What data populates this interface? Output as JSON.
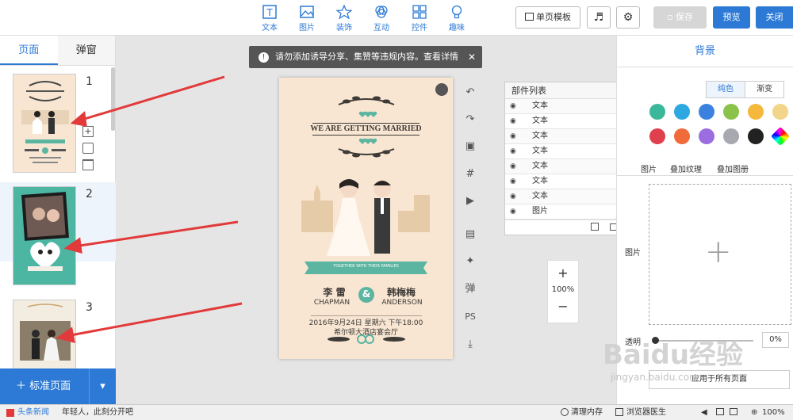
{
  "toolbar": {
    "tools": [
      "文本",
      "图片",
      "装饰",
      "互动",
      "控件",
      "趣味"
    ],
    "single_template": "单页模板",
    "save": "保存",
    "preview": "预览",
    "close": "关闭"
  },
  "left_panel": {
    "tabs": [
      "页面",
      "弹窗"
    ],
    "pages": [
      "1",
      "2",
      "3"
    ],
    "add_page": "标准页面"
  },
  "notice": "请勿添加诱导分享、集赞等违规内容。查看详情",
  "card": {
    "headline": "WE ARE GETTING MARRIED",
    "ribbon": "TOGETHER WITH THEIR FAMILIES",
    "groom_cn": "李 雷",
    "bride_cn": "韩梅梅",
    "groom_en": "CHAPMAN",
    "bride_en": "ANDERSON",
    "amp": "&",
    "date": "2016年9月24日 星期六 下午18:00",
    "venue": "希尔顿大酒店宴会厅"
  },
  "parts_panel": {
    "title": "部件列表",
    "items": [
      "文本",
      "文本",
      "文本",
      "文本",
      "文本",
      "文本",
      "文本",
      "图片"
    ]
  },
  "zoom": {
    "value": "100%",
    "plus": "+",
    "minus": "−"
  },
  "right_panel": {
    "title": "背景",
    "tabs": [
      "纯色",
      "渐变"
    ],
    "sub_tabs": [
      "图片",
      "叠加纹理",
      "叠加图册"
    ],
    "image_label": "图片",
    "opacity_label": "透明",
    "opacity_value": "0%",
    "apply_all": "应用于所有页面",
    "swatches": [
      "#3bb89a",
      "#2ea8e0",
      "#3b82e0",
      "#8bc34a",
      "#f5b83d",
      "#f2d48a",
      "#e0404e",
      "#f06a3a",
      "#9b6de0",
      "#a8a8b0",
      "#222222",
      "rainbow"
    ]
  },
  "rtools": [
    "弹",
    "PS"
  ],
  "statusbar": {
    "left": "头条新闻",
    "ticker": "年轻人，此刻分开吧",
    "clear": "清理内存",
    "doctor": "浏览器医生",
    "zoom": "100%"
  },
  "watermark": {
    "text": "Baidu经验",
    "url": "jingyan.baidu.com"
  }
}
